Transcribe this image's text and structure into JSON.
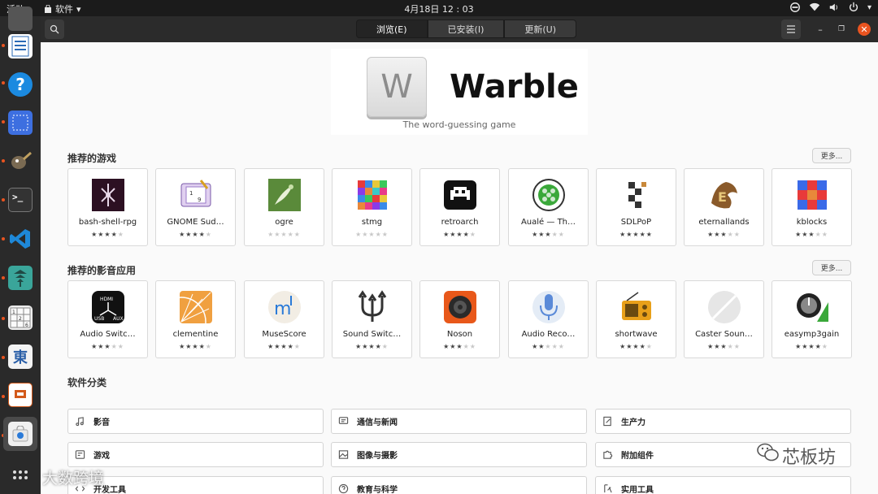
{
  "topbar": {
    "activities": "活动",
    "app": "软件",
    "clock": "4月18日  12 : 03"
  },
  "header": {
    "tabs": [
      "浏览(E)",
      "已安装(I)",
      "更新(U)"
    ]
  },
  "banner": {
    "icon_letter": "W",
    "title": "Warble",
    "subtitle": "The word-guessing game"
  },
  "games": {
    "title": "推荐的游戏",
    "more": "更多...",
    "items": [
      {
        "name": "bash-shell-rpg",
        "stars": 4,
        "icon": "bash-shell-rpg-icon"
      },
      {
        "name": "GNOME Sud…",
        "stars": 4,
        "icon": "sudoku-icon"
      },
      {
        "name": "ogre",
        "stars": 0,
        "icon": "ogre-icon"
      },
      {
        "name": "stmg",
        "stars": 0,
        "icon": "stmg-icon"
      },
      {
        "name": "retroarch",
        "stars": 4,
        "icon": "retroarch-icon"
      },
      {
        "name": "Aualé — Th…",
        "stars": 3,
        "icon": "auale-icon"
      },
      {
        "name": "SDLPoP",
        "stars": 5,
        "icon": "sdlpop-icon"
      },
      {
        "name": "eternallands",
        "stars": 3,
        "icon": "eternallands-icon"
      },
      {
        "name": "kblocks",
        "stars": 3,
        "icon": "kblocks-icon"
      }
    ]
  },
  "media": {
    "title": "推荐的影音应用",
    "more": "更多...",
    "items": [
      {
        "name": "Audio Switc…",
        "stars": 3,
        "icon": "hdmi-switch-icon"
      },
      {
        "name": "clementine",
        "stars": 4,
        "icon": "clementine-icon"
      },
      {
        "name": "MuseScore",
        "stars": 4,
        "icon": "musescore-icon"
      },
      {
        "name": "Sound Switc…",
        "stars": 4,
        "icon": "sound-switcher-icon"
      },
      {
        "name": "Noson",
        "stars": 3,
        "icon": "noson-icon"
      },
      {
        "name": "Audio Reco…",
        "stars": 2,
        "icon": "microphone-icon"
      },
      {
        "name": "shortwave",
        "stars": 4,
        "icon": "radio-icon"
      },
      {
        "name": "Caster Soun…",
        "stars": 3,
        "icon": "caster-icon"
      },
      {
        "name": "easymp3gain",
        "stars": 4,
        "icon": "easymp3gain-icon"
      }
    ]
  },
  "categories": {
    "title": "软件分类",
    "items": [
      {
        "label": "影音",
        "icon": "music-note-icon"
      },
      {
        "label": "通信与新闻",
        "icon": "chat-icon"
      },
      {
        "label": "生产力",
        "icon": "document-edit-icon"
      },
      {
        "label": "游戏",
        "icon": "gamepad-icon"
      },
      {
        "label": "图像与摄影",
        "icon": "image-icon"
      },
      {
        "label": "附加组件",
        "icon": "puzzle-icon"
      },
      {
        "label": "开发工具",
        "icon": "developer-icon"
      },
      {
        "label": "教育与科学",
        "icon": "question-circle-icon"
      },
      {
        "label": "实用工具",
        "icon": "tools-icon"
      }
    ]
  },
  "watermarks": {
    "left": "大数跨境",
    "right": "芯板坊"
  },
  "colors": {
    "accent": "#e95420",
    "tile_border": "#d9d9d9",
    "page_bg": "#fafafa"
  }
}
